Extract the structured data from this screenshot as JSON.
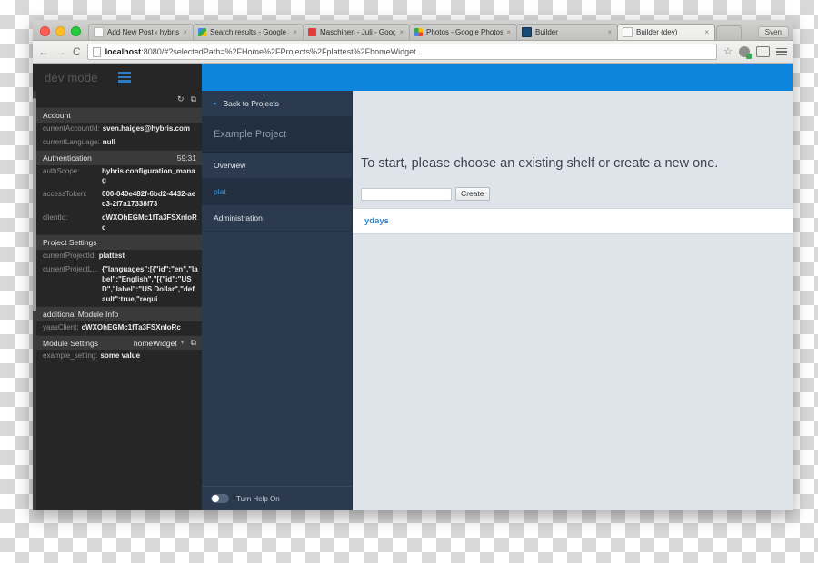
{
  "browser": {
    "user_chip": "Sven",
    "tabs": [
      {
        "label": "Add New Post ‹ hybris lab",
        "favicon": "doc-icon",
        "close": "×",
        "active": false
      },
      {
        "label": "Search results - Google Dr",
        "favicon": "google-drive-icon",
        "close": "×",
        "active": false
      },
      {
        "label": "Maschinen - Juli - Google",
        "favicon": "music-icon",
        "close": "×",
        "active": false
      },
      {
        "label": "Photos - Google Photos",
        "favicon": "google-photos-icon",
        "close": "×",
        "active": false
      },
      {
        "label": "Builder",
        "favicon": "builder-icon",
        "close": "×",
        "active": false
      },
      {
        "label": "Builder (dev)",
        "favicon": "doc-icon",
        "close": "×",
        "active": true
      }
    ],
    "nav": {
      "back": "←",
      "forward": "→",
      "reload": "C"
    },
    "url": {
      "host": "localhost",
      "path": ":8080/#?selectedPath=%2FHome%2FProjects%2Fplattest%2FhomeWidget"
    },
    "toolbar_icons": [
      "star-icon",
      "extension-icon",
      "cast-icon",
      "chrome-menu-icon"
    ]
  },
  "devpanel": {
    "title": "dev mode",
    "tools": {
      "refresh": "↻",
      "edit": "⧉"
    },
    "sections": [
      {
        "title": "Account",
        "meta": "",
        "rows": [
          {
            "key": "currentAccountId:",
            "value": "sven.haiges@hybris.com"
          },
          {
            "key": "currentLanguage:",
            "value": "null"
          }
        ]
      },
      {
        "title": "Authentication",
        "meta": "59:31",
        "rows": [
          {
            "key": "authScope:",
            "value": "hybris.configuration_manag"
          },
          {
            "key": "accessToken:",
            "value": "000-040e482f-6bd2-4432-aec3-2f7a17338f73"
          },
          {
            "key": "clientId:",
            "value": "cWXOhEGMc1fTa3FSXnIoRc"
          }
        ]
      },
      {
        "title": "Project Settings",
        "meta": "",
        "rows": [
          {
            "key": "currentProjectId:",
            "value": "plattest"
          },
          {
            "key": "currentProjectL...",
            "value": "{\"languages\":[{\"id\":\"en\",\"label\":\"English\",\"[{\"id\":\"USD\",\"label\":\"US Dollar\",\"default\":true,\"requi"
          }
        ]
      },
      {
        "title": "additional Module Info",
        "meta": "",
        "rows": [
          {
            "key": "yaasClient:",
            "value": "cWXOhEGMc1fTa3FSXnIoRc"
          }
        ]
      }
    ],
    "module_settings": {
      "label": "Module Settings",
      "selected": "homeWidget",
      "caret": "▼",
      "external_icon": "⧉",
      "rows": [
        {
          "key": "example_setting:",
          "value": "some value"
        }
      ]
    }
  },
  "app": {
    "nav": {
      "back_label": "Back to Projects",
      "back_arrow": "◂",
      "project_name": "Example Project",
      "items": [
        {
          "label": "Overview",
          "active": false
        },
        {
          "label": "plat",
          "active": true
        },
        {
          "label": "Administration",
          "active": false
        }
      ],
      "help_label": "Turn Help On"
    },
    "content": {
      "heading": "To start, please choose an existing shelf or create a new one.",
      "create_input_value": "",
      "create_input_placeholder": "",
      "create_button": "Create",
      "shelves": [
        "ydays"
      ]
    }
  },
  "colors": {
    "banner_blue": "#0e85dd",
    "accent_blue": "#2f86d4",
    "nav_bg": "#2b3a4f",
    "nav_active": "#222f41",
    "dev_bg": "#262626",
    "content_bg": "#dfe4ea"
  }
}
